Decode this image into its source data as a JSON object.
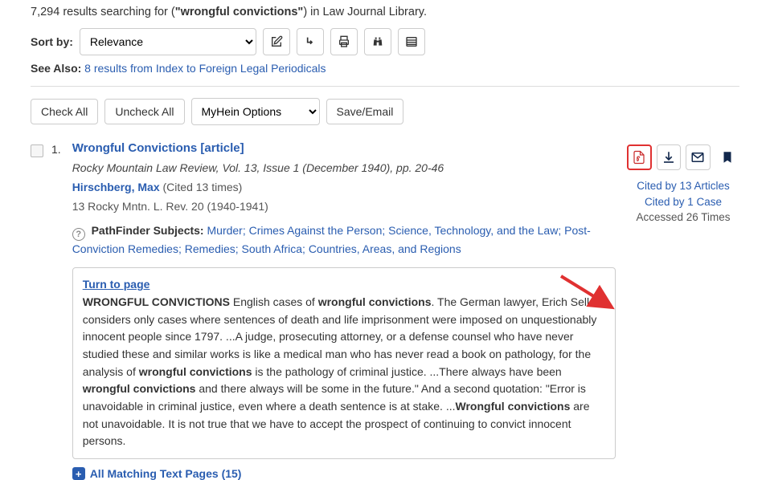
{
  "header": {
    "count": "7,294",
    "prefix": "results searching for (",
    "term": "\"wrongful convictions\"",
    "suffix": ") in Law Journal Library."
  },
  "sort": {
    "label": "Sort by:",
    "selected": "Relevance"
  },
  "seeAlso": {
    "label": "See Also:",
    "link": "8 results from Index to Foreign Legal Periodicals"
  },
  "actions": {
    "checkAll": "Check All",
    "uncheckAll": "Uncheck All",
    "myhein": "MyHein Options",
    "saveEmail": "Save/Email"
  },
  "result": {
    "num": "1.",
    "title": "Wrongful Convictions [article]",
    "citation": "Rocky Mountain Law Review, Vol. 13, Issue 1 (December 1940), pp. 20-46",
    "author": "Hirschberg, Max",
    "citedTimes": " (Cited 13 times)",
    "shortCite": "13 Rocky Mntn. L. Rev. 20 (1940-1941)",
    "subjectsLabel": "PathFinder Subjects:",
    "subjects": " Murder; Crimes Against the Person; Science, Technology, and the Law; Post-Conviction Remedies; Remedies; South Africa; Countries, Areas, and Regions",
    "turnToPage": "Turn to page",
    "snippet_p1a": "WRONGFUL CONVICTIONS",
    "snippet_p1b": " English cases of ",
    "snippet_p1c": "wrongful convictions",
    "snippet_p1d": ". The German lawyer, Erich Sello,4 considers only cases where sentences of death and life imprisonment were imposed on unquestionably innocent people since 1797. ...A judge, prosecuting attorney, or a defense counsel who have never studied these and similar works is like a medical man who has never read a book on pathology, for the analysis of ",
    "snippet_p1e": "wrongful convictions",
    "snippet_p1f": " is the pathology of criminal justice. ...There always have been ",
    "snippet_p1g": "wrongful convictions",
    "snippet_p1h": " and there always will be some in the future.\" And a second quotation: \"Error is unavoidable in criminal justice, even where a death sentence is at stake. ...",
    "snippet_p1i": "Wrongful convictions",
    "snippet_p1j": " are not unavoidable. It is not true that we have to accept the prospect of continuing to convict innocent persons.",
    "matchingPages": "All Matching Text Pages (15)"
  },
  "side": {
    "citedArticles": "Cited by 13 Articles",
    "citedCases": "Cited by 1 Case",
    "accessed": "Accessed 26 Times"
  }
}
